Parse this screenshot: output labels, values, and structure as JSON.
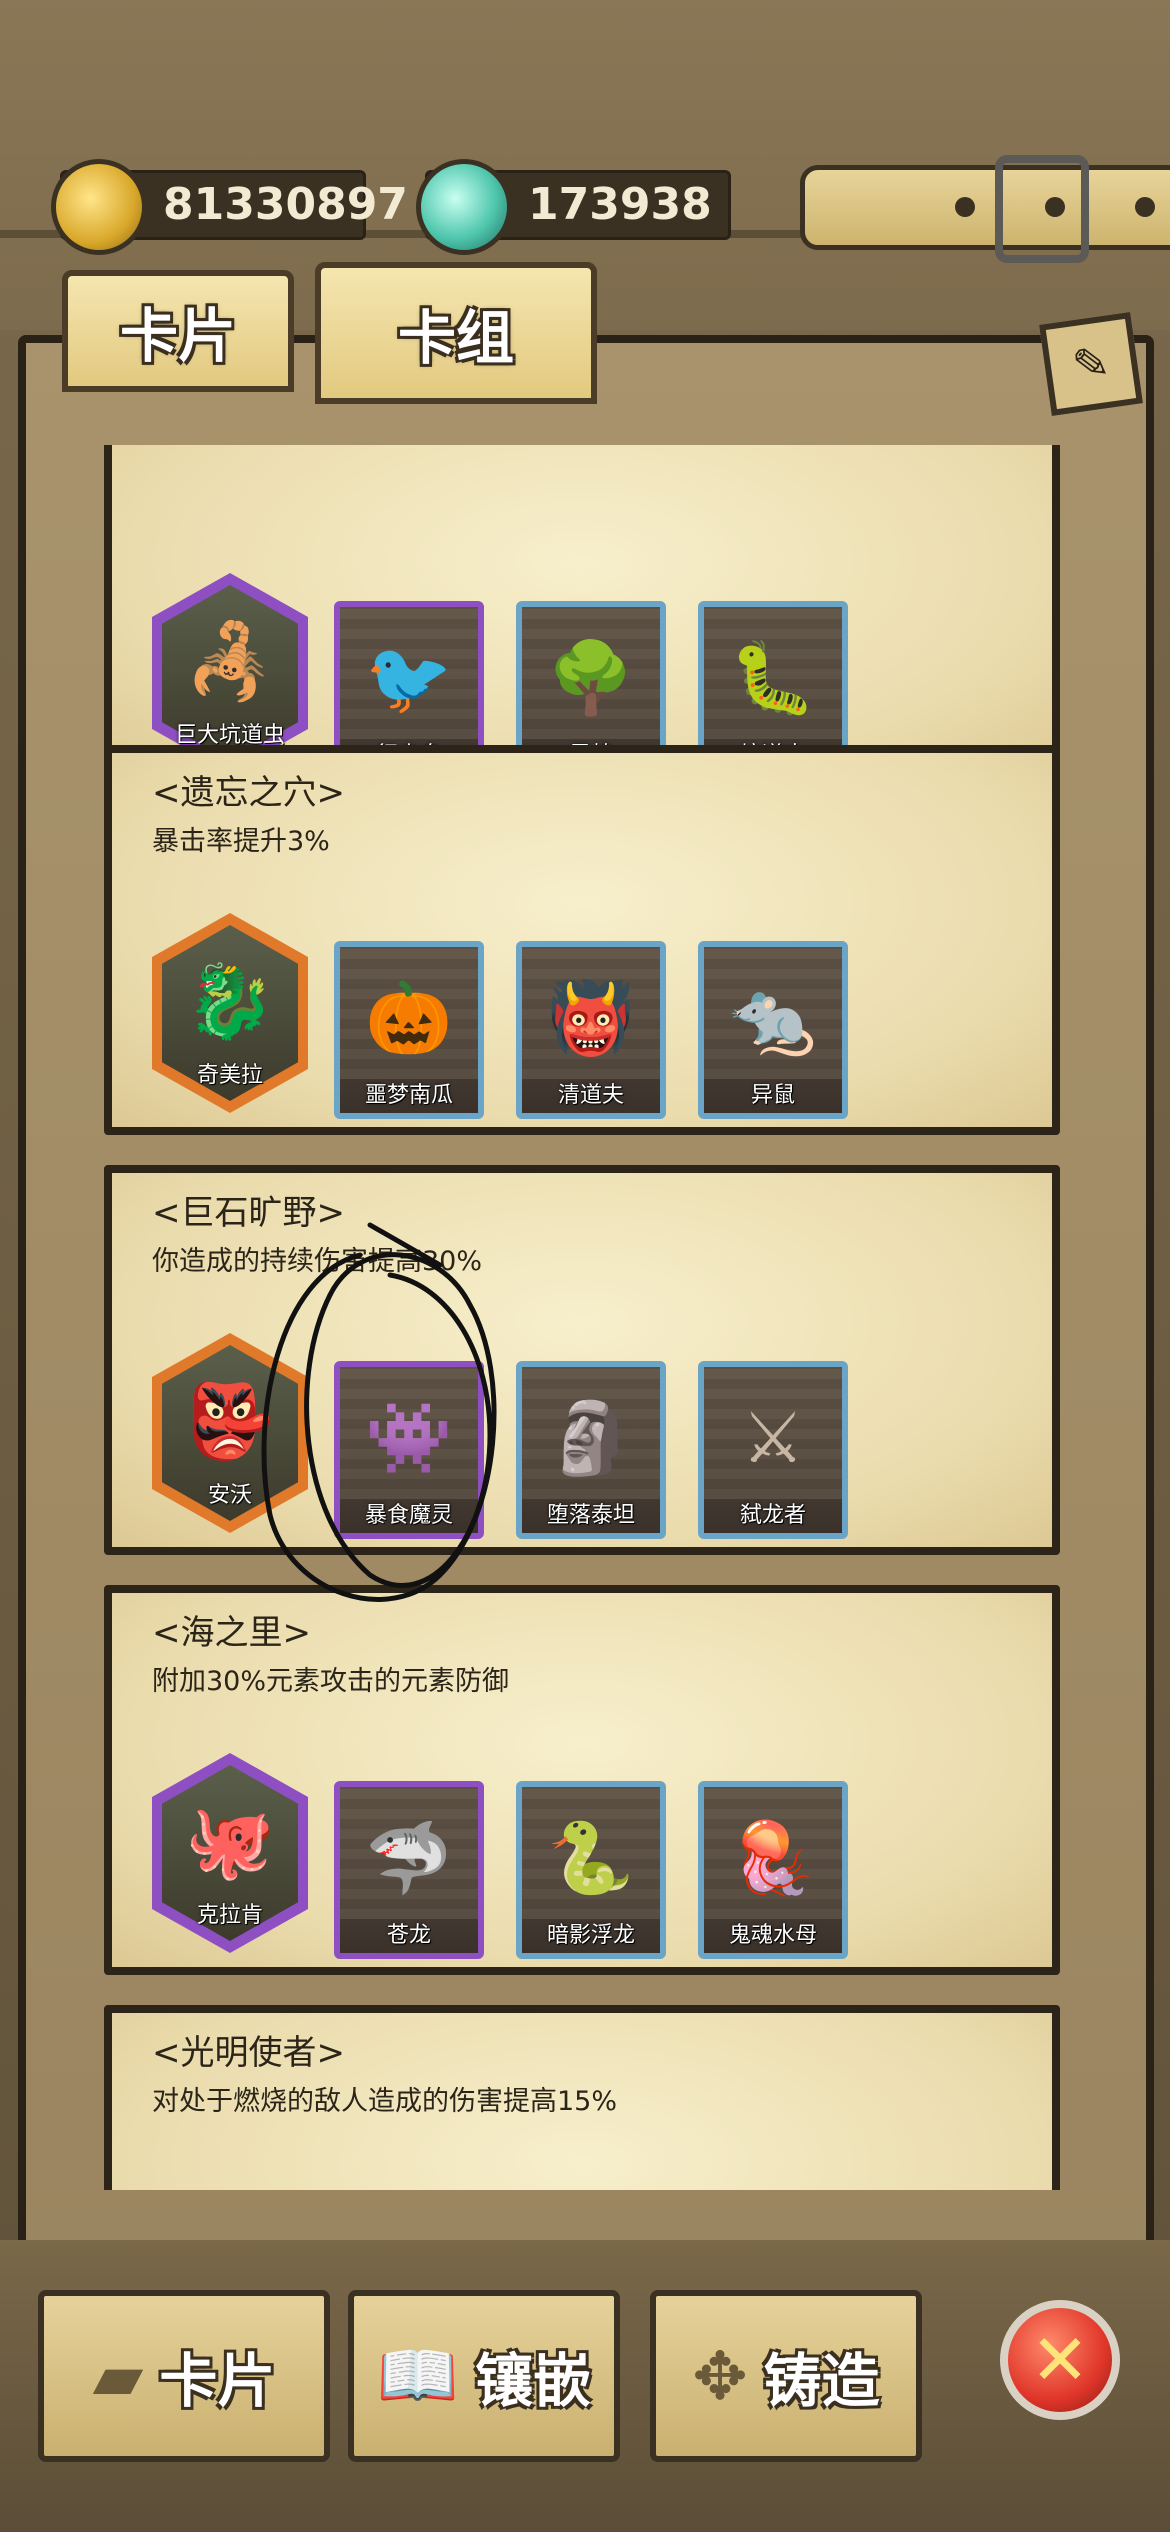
{
  "currency": {
    "gold": "81330897",
    "gems": "173938"
  },
  "tabs": {
    "cards": "卡片",
    "decks": "卡组"
  },
  "sets": [
    {
      "name": "",
      "desc": "",
      "cards": [
        {
          "label": "巨大坑道虫",
          "frame": "hex-purple",
          "glyph": "🦂"
        },
        {
          "label": "行走鸟",
          "frame": "purple",
          "glyph": "🐦"
        },
        {
          "label": "恩特",
          "frame": "blue",
          "glyph": "🌳"
        },
        {
          "label": "坑道虫",
          "frame": "blue",
          "glyph": "🐛"
        }
      ]
    },
    {
      "name": "<遗忘之穴>",
      "desc": "暴击率提升3%",
      "cards": [
        {
          "label": "奇美拉",
          "frame": "hex-orange",
          "glyph": "🐉"
        },
        {
          "label": "噩梦南瓜",
          "frame": "blue",
          "glyph": "🎃"
        },
        {
          "label": "清道夫",
          "frame": "blue",
          "glyph": "👹"
        },
        {
          "label": "异鼠",
          "frame": "blue",
          "glyph": "🐀"
        }
      ]
    },
    {
      "name": "<巨石旷野>",
      "desc": "你造成的持续伤害提高30%",
      "cards": [
        {
          "label": "安沃",
          "frame": "hex-orange",
          "glyph": "👺"
        },
        {
          "label": "暴食魔灵",
          "frame": "purple",
          "glyph": "👾"
        },
        {
          "label": "堕落泰坦",
          "frame": "blue",
          "glyph": "🗿"
        },
        {
          "label": "弑龙者",
          "frame": "blue",
          "glyph": "⚔"
        }
      ]
    },
    {
      "name": "<海之里>",
      "desc": "附加30%元素攻击的元素防御",
      "cards": [
        {
          "label": "克拉肯",
          "frame": "hex-purple",
          "glyph": "🐙"
        },
        {
          "label": "苍龙",
          "frame": "purple",
          "glyph": "🦈"
        },
        {
          "label": "暗影浮龙",
          "frame": "blue",
          "glyph": "🐍"
        },
        {
          "label": "鬼魂水母",
          "frame": "blue",
          "glyph": "🪼"
        }
      ]
    },
    {
      "name": "<光明使者>",
      "desc": "对处于燃烧的敌人造成的伤害提高15%",
      "cards": []
    }
  ],
  "bottom": {
    "cards": "卡片",
    "inlay": "镶嵌",
    "forge": "铸造"
  },
  "icons": {
    "gold": "gold-ore-icon",
    "gems": "gem-icon",
    "edit": "brush-icon",
    "close": "close-icon"
  }
}
